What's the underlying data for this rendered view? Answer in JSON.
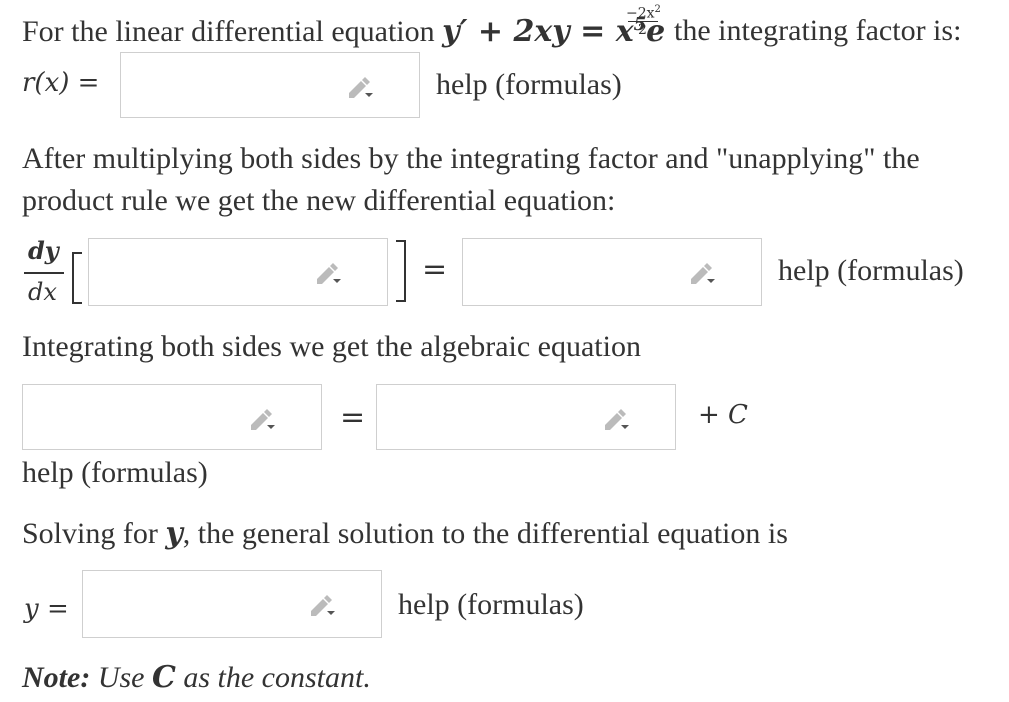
{
  "q1": {
    "prefix": "For the linear differential equation",
    "equation": {
      "lhs": "y′ + 2xy = x",
      "x_power": "5",
      "exp_base": "e",
      "exp_num": "−2x",
      "exp_num_power": "2",
      "exp_den": "2"
    },
    "suffix": "the integrating factor is:",
    "answer_label": "r(x) =",
    "help": "help (formulas)"
  },
  "q2": {
    "text_line1": "After multiplying both sides by the integrating factor and \"unapplying\" the",
    "text_line2": "product rule we get the new differential equation:",
    "deriv_num": "dy",
    "deriv_den": "dx",
    "equals": "=",
    "help": "help (formulas)"
  },
  "q3": {
    "text": "Integrating both sides we get the algebraic equation",
    "equals": "=",
    "plus_c": "+ C",
    "help": "help (formulas)"
  },
  "q4": {
    "text_before": "Solving for",
    "var": "y",
    "text_after": ", the general solution to the differential equation is",
    "answer_label": "y =",
    "help": "help (formulas)"
  },
  "note": {
    "label": "Note:",
    "text_before": "Use",
    "constant": "C",
    "text_after": "as the constant."
  },
  "icons": {
    "pen": "pencil-edit-icon"
  }
}
